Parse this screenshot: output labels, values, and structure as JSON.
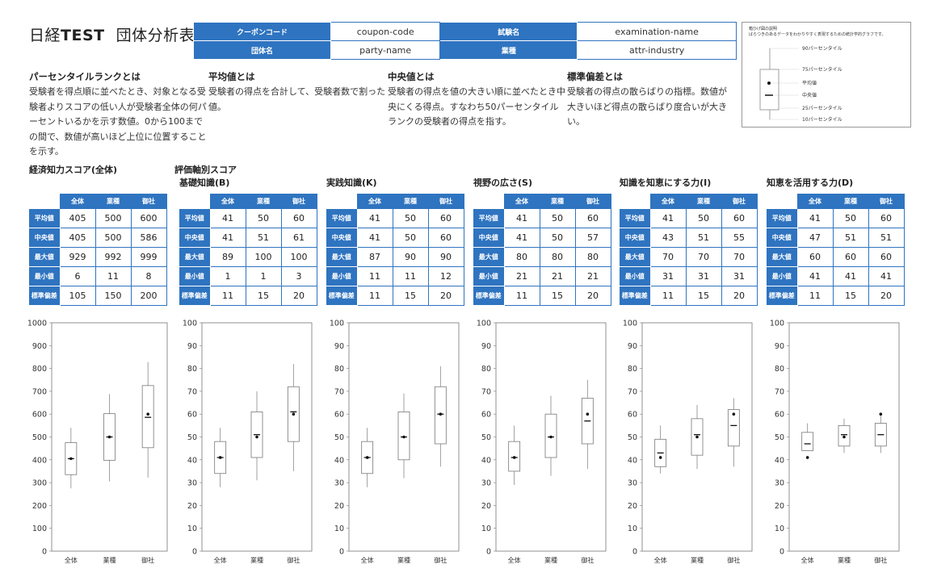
{
  "header": {
    "title_prefix": "日経",
    "title_bold": "TEST",
    "title_suffix": "団体分析表"
  },
  "meta": {
    "coupon_label": "クーポンコード",
    "coupon_value": "coupon-code",
    "exam_label": "試験名",
    "exam_value": "examination-name",
    "party_label": "団体名",
    "party_value": "party-name",
    "industry_label": "業種",
    "industry_value": "attr-industry"
  },
  "definitions": [
    {
      "title": "パーセンタイルランクとは",
      "body": "受験者を得点順に並べたとき、対象となる受験者よりスコアの低い人が受験者全体の何パーセントいるかを示す数値。0から100までの間で、数値が高いほど上位に位置することを示す。"
    },
    {
      "title": "平均値とは",
      "body": "受験者の得点を合計して、受験者数で割った値。"
    },
    {
      "title": "中央値とは",
      "body": "受験者の得点を値の大きい順に並べたとき中央にくる得点。すなわち50パーセンタイルランクの受験者の得点を指す。"
    },
    {
      "title": "標準偏差とは",
      "body": "受験者の得点の散らばりの指標。数値が大きいほど得点の散らばり度合いが大きい。"
    }
  ],
  "legend": {
    "title": "箱ひげ図の説明",
    "subtitle": "ばらつきのあるデータをわかりやすく表現するための統計学的グラフです。",
    "labels": [
      "90パーセンタイル",
      "75パーセンタイル",
      "平均値",
      "中央値",
      "25パーセンタイル",
      "10パーセンタイル"
    ]
  },
  "sections": {
    "overall": "経済知力スコア(全体)",
    "axes": "評価軸別スコア"
  },
  "table_headers": {
    "columns": [
      "全体",
      "業種",
      "御社"
    ],
    "rows": [
      "平均値",
      "中央値",
      "最大値",
      "最小値",
      "標準偏差"
    ]
  },
  "chart_data": [
    {
      "type": "box",
      "title": "経済知力スコア(全体)",
      "categories": [
        "全体",
        "業種",
        "御社"
      ],
      "ylim": [
        0,
        1000
      ],
      "yticks": [
        0,
        100,
        200,
        300,
        400,
        500,
        600,
        700,
        800,
        900,
        1000
      ],
      "stats": {
        "平均値": [
          405,
          500,
          600
        ],
        "中央値": [
          405,
          500,
          586
        ],
        "最大値": [
          929,
          992,
          999
        ],
        "最小値": [
          6,
          11,
          8
        ],
        "標準偏差": [
          105,
          150,
          200
        ]
      },
      "boxes": [
        {
          "p10": 275,
          "p25": 335,
          "median": 405,
          "p75": 475,
          "p90": 540,
          "mean": 405
        },
        {
          "p10": 305,
          "p25": 398,
          "median": 500,
          "p75": 602,
          "p90": 688,
          "mean": 500
        },
        {
          "p10": 322,
          "p25": 453,
          "median": 586,
          "p75": 725,
          "p90": 828,
          "mean": 600
        }
      ]
    },
    {
      "type": "box",
      "title": "基礎知識(B)",
      "categories": [
        "全体",
        "業種",
        "御社"
      ],
      "ylim": [
        0,
        100
      ],
      "yticks": [
        0,
        10,
        20,
        30,
        40,
        50,
        60,
        70,
        80,
        90,
        100
      ],
      "stats": {
        "平均値": [
          41,
          50,
          60
        ],
        "中央値": [
          41,
          51,
          61
        ],
        "最大値": [
          89,
          100,
          100
        ],
        "最小値": [
          1,
          1,
          3
        ],
        "標準偏差": [
          11,
          15,
          20
        ]
      },
      "boxes": [
        {
          "p10": 28,
          "p25": 34,
          "median": 41,
          "p75": 48,
          "p90": 54,
          "mean": 41
        },
        {
          "p10": 31,
          "p25": 41,
          "median": 51,
          "p75": 61,
          "p90": 70,
          "mean": 50
        },
        {
          "p10": 35,
          "p25": 48,
          "median": 61,
          "p75": 72,
          "p90": 82,
          "mean": 60
        }
      ]
    },
    {
      "type": "box",
      "title": "実践知識(K)",
      "categories": [
        "全体",
        "業種",
        "御社"
      ],
      "ylim": [
        0,
        100
      ],
      "yticks": [
        0,
        10,
        20,
        30,
        40,
        50,
        60,
        70,
        80,
        90,
        100
      ],
      "stats": {
        "平均値": [
          41,
          50,
          60
        ],
        "中央値": [
          41,
          50,
          60
        ],
        "最大値": [
          87,
          90,
          90
        ],
        "最小値": [
          11,
          11,
          12
        ],
        "標準偏差": [
          11,
          15,
          20
        ]
      },
      "boxes": [
        {
          "p10": 28,
          "p25": 34,
          "median": 41,
          "p75": 48,
          "p90": 54,
          "mean": 41
        },
        {
          "p10": 32,
          "p25": 40,
          "median": 50,
          "p75": 61,
          "p90": 69,
          "mean": 50
        },
        {
          "p10": 37,
          "p25": 47,
          "median": 60,
          "p75": 72,
          "p90": 81,
          "mean": 60
        }
      ]
    },
    {
      "type": "box",
      "title": "視野の広さ(S)",
      "categories": [
        "全体",
        "業種",
        "御社"
      ],
      "ylim": [
        0,
        100
      ],
      "yticks": [
        0,
        10,
        20,
        30,
        40,
        50,
        60,
        70,
        80,
        90,
        100
      ],
      "stats": {
        "平均値": [
          41,
          50,
          60
        ],
        "中央値": [
          41,
          50,
          57
        ],
        "最大値": [
          80,
          80,
          80
        ],
        "最小値": [
          21,
          21,
          21
        ],
        "標準偏差": [
          11,
          15,
          20
        ]
      },
      "boxes": [
        {
          "p10": 29,
          "p25": 35,
          "median": 41,
          "p75": 48,
          "p90": 55,
          "mean": 41
        },
        {
          "p10": 33,
          "p25": 41,
          "median": 50,
          "p75": 60,
          "p90": 68,
          "mean": 50
        },
        {
          "p10": 36,
          "p25": 47,
          "median": 57,
          "p75": 67,
          "p90": 75,
          "mean": 60
        }
      ]
    },
    {
      "type": "box",
      "title": "知識を知恵にする力(I)",
      "categories": [
        "全体",
        "業種",
        "御社"
      ],
      "ylim": [
        0,
        100
      ],
      "yticks": [
        0,
        10,
        20,
        30,
        40,
        50,
        60,
        70,
        80,
        90,
        100
      ],
      "stats": {
        "平均値": [
          41,
          50,
          60
        ],
        "中央値": [
          43,
          51,
          55
        ],
        "最大値": [
          70,
          70,
          70
        ],
        "最小値": [
          31,
          31,
          31
        ],
        "標準偏差": [
          11,
          15,
          20
        ]
      },
      "boxes": [
        {
          "p10": 34,
          "p25": 37,
          "median": 43,
          "p75": 49,
          "p90": 55,
          "mean": 41
        },
        {
          "p10": 36,
          "p25": 42,
          "median": 51,
          "p75": 58,
          "p90": 64,
          "mean": 50
        },
        {
          "p10": 37,
          "p25": 46,
          "median": 55,
          "p75": 62,
          "p90": 67,
          "mean": 60
        }
      ]
    },
    {
      "type": "box",
      "title": "知恵を活用する力(D)",
      "categories": [
        "全体",
        "業種",
        "御社"
      ],
      "ylim": [
        0,
        100
      ],
      "yticks": [
        0,
        10,
        20,
        30,
        40,
        50,
        60,
        70,
        80,
        90,
        100
      ],
      "stats": {
        "平均値": [
          41,
          50,
          60
        ],
        "中央値": [
          47,
          51,
          51
        ],
        "最大値": [
          60,
          60,
          60
        ],
        "最小値": [
          41,
          41,
          41
        ],
        "標準偏差": [
          11,
          15,
          20
        ]
      },
      "boxes": [
        {
          "p10": 44,
          "p25": 44,
          "median": 47,
          "p75": 52,
          "p90": 56,
          "mean": 41
        },
        {
          "p10": 43,
          "p25": 46,
          "median": 51,
          "p75": 55,
          "p90": 58,
          "mean": 50
        },
        {
          "p10": 43,
          "p25": 46,
          "median": 51,
          "p75": 56,
          "p90": 60,
          "mean": 60
        }
      ]
    }
  ]
}
